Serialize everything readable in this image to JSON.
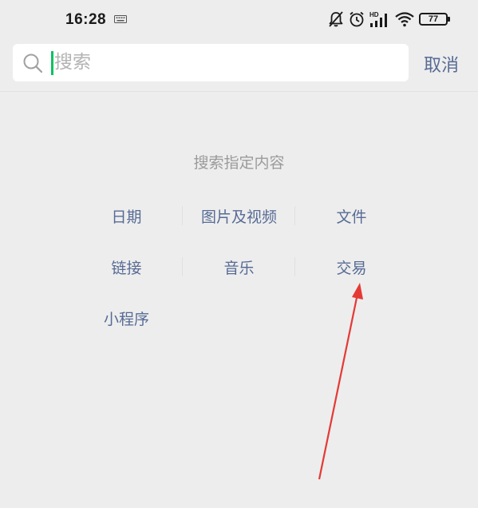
{
  "status_bar": {
    "time": "16:28",
    "battery": "77",
    "icons": [
      "keyboard-icon",
      "mute-bell-icon",
      "alarm-icon",
      "hd-signal-icon",
      "wifi-icon",
      "battery-icon"
    ]
  },
  "search": {
    "placeholder": "搜索",
    "value": "",
    "cancel_label": "取消"
  },
  "section": {
    "title": "搜索指定内容"
  },
  "categories": [
    [
      "日期",
      "图片及视频",
      "文件"
    ],
    [
      "链接",
      "音乐",
      "交易"
    ],
    [
      "小程序"
    ]
  ],
  "colors": {
    "background": "#ededed",
    "link": "#576b95",
    "caret": "#07c160",
    "annotation_arrow": "#e53935"
  }
}
